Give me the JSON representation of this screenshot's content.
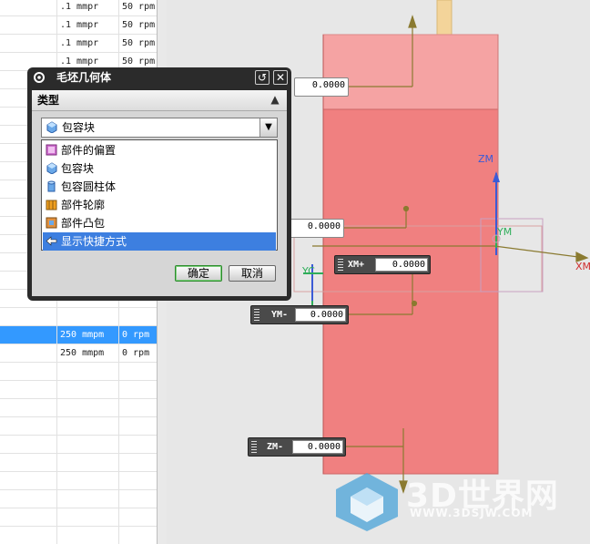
{
  "table": {
    "rows": [
      {
        "feed": ".1 mmpr",
        "speed": "50 rpm",
        "selected": false
      },
      {
        "feed": ".1 mmpr",
        "speed": "50 rpm",
        "selected": false
      },
      {
        "feed": ".1 mmpr",
        "speed": "50 rpm",
        "selected": false
      },
      {
        "feed": ".1 mmpr",
        "speed": "50 rpm",
        "selected": false
      },
      {
        "feed": "",
        "speed": "",
        "selected": false
      },
      {
        "feed": "",
        "speed": "",
        "selected": false
      },
      {
        "feed": "",
        "speed": "",
        "selected": false
      },
      {
        "feed": "",
        "speed": "",
        "selected": false
      },
      {
        "feed": "",
        "speed": "",
        "selected": false
      },
      {
        "feed": "",
        "speed": "",
        "selected": false
      },
      {
        "feed": "",
        "speed": "",
        "selected": false
      },
      {
        "feed": "",
        "speed": "",
        "selected": false
      },
      {
        "feed": "",
        "speed": "",
        "selected": false
      },
      {
        "feed": "",
        "speed": "",
        "selected": false
      },
      {
        "feed": "",
        "speed": "",
        "selected": false
      },
      {
        "feed": "",
        "speed": "",
        "selected": false
      },
      {
        "feed": "",
        "speed": "",
        "selected": false
      },
      {
        "feed": "",
        "speed": "",
        "selected": false
      },
      {
        "feed": "250 mmpm",
        "speed": "0 rpm",
        "selected": true
      },
      {
        "feed": "250 mmpm",
        "speed": "0 rpm",
        "selected": false
      },
      {
        "feed": "",
        "speed": "",
        "selected": false
      },
      {
        "feed": "",
        "speed": "",
        "selected": false
      },
      {
        "feed": "",
        "speed": "",
        "selected": false
      },
      {
        "feed": "",
        "speed": "",
        "selected": false
      },
      {
        "feed": "",
        "speed": "",
        "selected": false
      },
      {
        "feed": "",
        "speed": "",
        "selected": false
      },
      {
        "feed": "",
        "speed": "",
        "selected": false
      },
      {
        "feed": "",
        "speed": "",
        "selected": false
      },
      {
        "feed": "",
        "speed": "",
        "selected": false
      },
      {
        "feed": "",
        "speed": "",
        "selected": false
      }
    ]
  },
  "dialog": {
    "title": "毛坯几何体",
    "section_title": "类型",
    "selected_type": "包容块",
    "type_options": [
      "部件的偏置",
      "包容块",
      "包容圆柱体",
      "部件轮廓",
      "部件凸包",
      "显示快捷方式"
    ],
    "highlighted_option": "显示快捷方式",
    "ok_label": "确定",
    "cancel_label": "取消"
  },
  "handles": {
    "zplus_value": "0.0000",
    "left_value": "0.0000",
    "xplus_label": "XM+",
    "xplus_value": "0.0000",
    "yminus_label": "YM-",
    "yminus_value": "0.0000",
    "zminus_label": "ZM-",
    "zminus_value": "0.0000"
  },
  "axes": {
    "zm": "ZM",
    "ym": "YM",
    "xm": "XM",
    "yc": "YC"
  },
  "watermark": {
    "brand": "3D世界网",
    "url": "WWW.3DSJW.COM"
  },
  "colors": {
    "selection": "#3399ff",
    "block_fill": "#f08080",
    "dialog_frame": "#2b2b2b"
  }
}
